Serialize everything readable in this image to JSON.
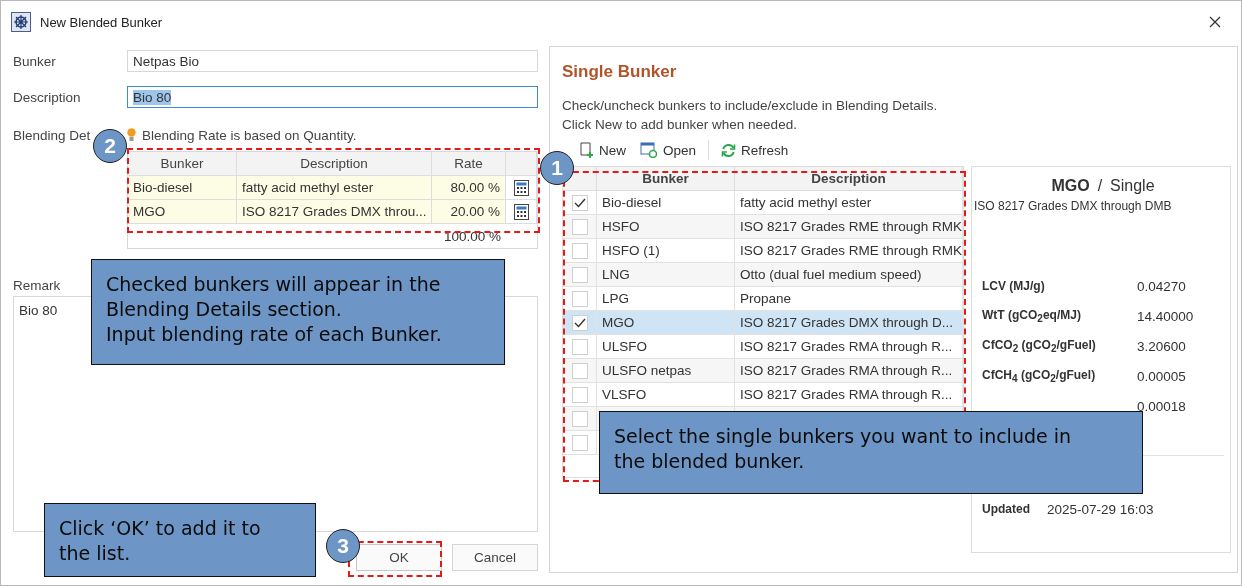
{
  "window": {
    "title": "New Blended Bunker"
  },
  "form": {
    "bunker_label": "Bunker",
    "bunker_value": "Netpas Bio",
    "description_label": "Description",
    "description_value": "Bio 80",
    "description_selected": true,
    "blending_label": "Blending Det",
    "blending_hint": "Blending Rate is based on Quantity.",
    "remark_label": "Remark",
    "remark_value": "Bio 80"
  },
  "blending_table": {
    "columns": [
      "Bunker",
      "Description",
      "Rate"
    ],
    "rows": [
      {
        "bunker": "Bio-diesel",
        "description": "fatty acid methyl ester",
        "rate": "80.00 %"
      },
      {
        "bunker": "MGO",
        "description": "ISO 8217 Grades DMX throu...",
        "rate": "20.00 %"
      }
    ],
    "total": "100.00 %"
  },
  "single_bunker": {
    "title": "Single Bunker",
    "instructions": [
      "Check/uncheck bunkers to include/exclude in Blending Details.",
      "Click New to add bunker when needed."
    ],
    "toolbar": [
      {
        "kind": "new",
        "label": "New"
      },
      {
        "kind": "open",
        "label": "Open"
      },
      {
        "kind": "refresh",
        "label": "Refresh"
      }
    ],
    "columns": [
      "Bunker",
      "Description"
    ],
    "rows": [
      {
        "bunker": "Bio-diesel",
        "description": "fatty acid methyl ester",
        "checked": true,
        "selected": false
      },
      {
        "bunker": "HSFO",
        "description": "ISO 8217 Grades RME through RMK",
        "checked": false,
        "selected": false
      },
      {
        "bunker": "HSFO (1)",
        "description": "ISO 8217 Grades RME through RMK",
        "checked": false,
        "selected": false
      },
      {
        "bunker": "LNG",
        "description": "Otto (dual fuel medium speed)",
        "checked": false,
        "selected": false
      },
      {
        "bunker": "LPG",
        "description": "Propane",
        "checked": false,
        "selected": false
      },
      {
        "bunker": "MGO",
        "description": "ISO 8217 Grades DMX through D...",
        "checked": true,
        "selected": true
      },
      {
        "bunker": "ULSFO",
        "description": "ISO 8217 Grades RMA through R...",
        "checked": false,
        "selected": false
      },
      {
        "bunker": "ULSFO netpas",
        "description": "ISO 8217 Grades RMA through R...",
        "checked": false,
        "selected": false
      },
      {
        "bunker": "VLSFO",
        "description": "ISO 8217 Grades RMA through R...",
        "checked": false,
        "selected": false
      },
      {
        "checked": false
      },
      {
        "checked": false
      }
    ]
  },
  "detail": {
    "name": "MGO",
    "separator": "/",
    "type": "Single",
    "description": "ISO 8217 Grades DMX through DMB",
    "properties": [
      {
        "label": "LCV (MJ/g)",
        "value": "0.04270"
      },
      {
        "label": "WtT (gCO$_{2}$eq/MJ)",
        "value": "14.40000"
      },
      {
        "label": "CfCO$_{2}$ (gCO$_{2}$/gFuel)",
        "value": "3.20600"
      },
      {
        "label": "CfCH$_{4}$ (gCO$_{2}$/gFuel)",
        "value": "0.00005"
      },
      {
        "value": "0.00018"
      }
    ],
    "updated_label": "Updated",
    "updated_value": "2025-07-29 16:03"
  },
  "buttons": [
    {
      "kind": "ok",
      "label": "OK"
    },
    {
      "kind": "cancel",
      "label": "Cancel"
    }
  ],
  "annotations": [
    {
      "number": "2",
      "text": [
        "Checked bunkers will appear in the",
        "Blending Details section.",
        "Input blending rate of each Bunker."
      ]
    },
    {
      "number": "1",
      "text": [
        "Select the single bunkers you want to include in",
        "the blended bunker."
      ]
    },
    {
      "number": "3",
      "text": [
        "Click ‘OK’ to add it to",
        "the list."
      ]
    }
  ]
}
